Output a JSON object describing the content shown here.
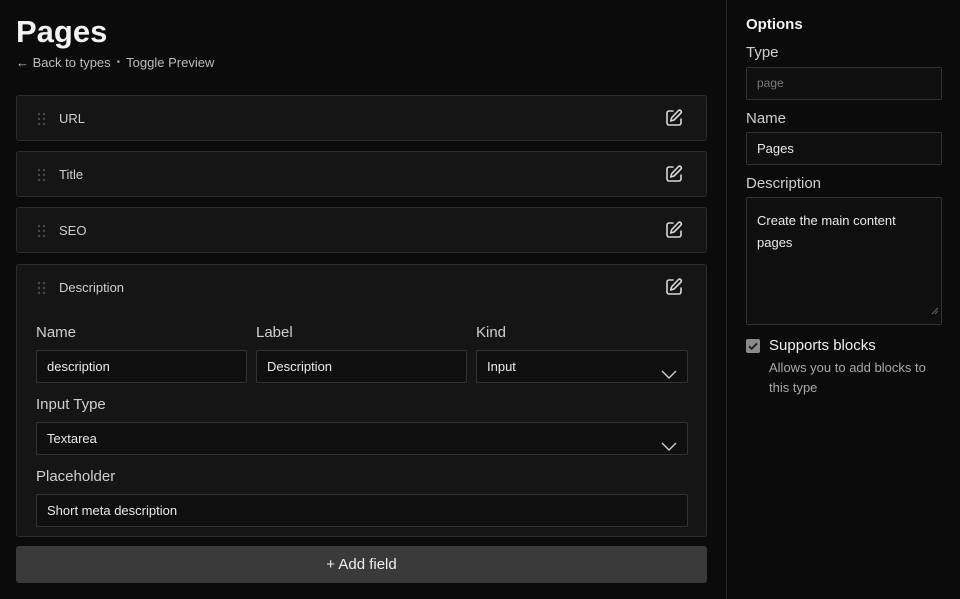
{
  "page": {
    "title": "Pages",
    "back_link": "← Back to types",
    "separator": "•",
    "toggle_preview": "Toggle Preview"
  },
  "fields": [
    {
      "label": "URL"
    },
    {
      "label": "Title"
    },
    {
      "label": "SEO"
    },
    {
      "label": "Description"
    }
  ],
  "expanded_field": {
    "name_label": "Name",
    "name_value": "description",
    "label_label": "Label",
    "label_value": "Description",
    "kind_label": "Kind",
    "kind_value": "Input",
    "input_type_label": "Input Type",
    "input_type_value": "Textarea",
    "placeholder_label": "Placeholder",
    "placeholder_value": "Short meta description"
  },
  "add_field_label": "+ Add field",
  "options": {
    "title": "Options",
    "type_label": "Type",
    "type_placeholder": "page",
    "name_label": "Name",
    "name_value": "Pages",
    "description_label": "Description",
    "description_value": "Create the main content pages",
    "supports_blocks_label": "Supports blocks",
    "supports_blocks_checked": true,
    "supports_blocks_help": "Allows you to add blocks to this type"
  },
  "icons": {
    "grip": "drag-handle-icon",
    "edit": "edit-icon",
    "chevron": "chevron-down-icon",
    "check": "checkmark-icon"
  }
}
